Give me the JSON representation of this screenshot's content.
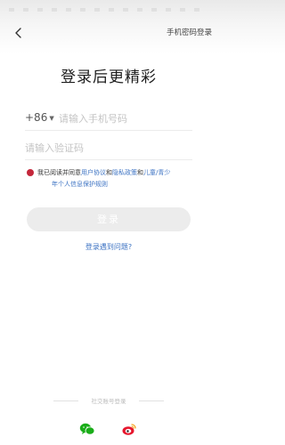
{
  "header": {
    "password_login_label": "手机密码登录"
  },
  "main": {
    "title": "登录后更精彩",
    "country_code": "+86",
    "phone_placeholder": "请输入手机号码",
    "code_placeholder": "请输入验证码",
    "login_label": "登录",
    "trouble_label": "登录遇到问题?"
  },
  "agreement": {
    "prefix": "我已阅读并同意",
    "user_agreement": "用户协议",
    "and1": "和",
    "privacy_policy": "隐私政策",
    "and2": "和",
    "children_link": "儿童/青少",
    "line2": "年个人信息保护规则"
  },
  "social": {
    "label": "社交账号登录",
    "icons": [
      "wechat-icon",
      "weibo-icon"
    ]
  },
  "colors": {
    "link": "#3d73c3",
    "check": "#c4273b",
    "button_disabled": "#ececec",
    "weibo": "#e6162d",
    "wechat": "#1aad19"
  }
}
